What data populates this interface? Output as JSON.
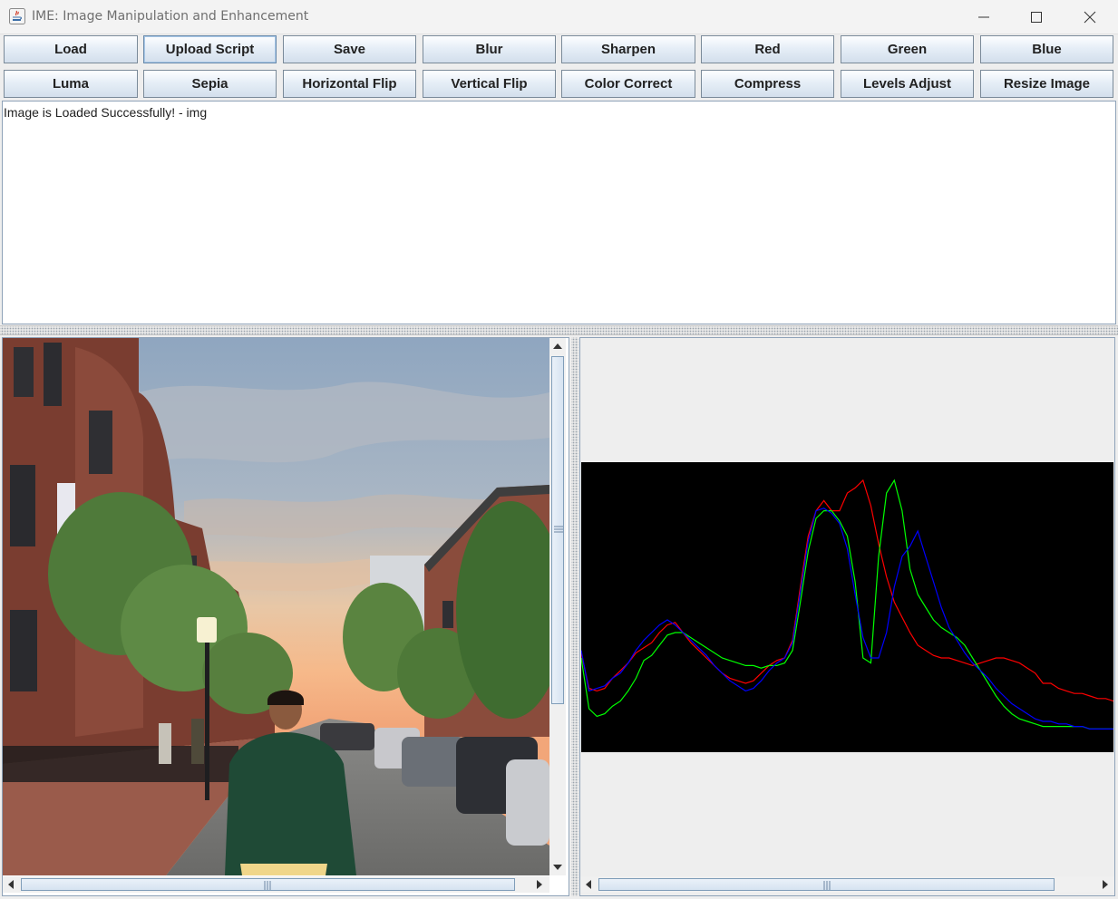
{
  "window": {
    "title": "IME: Image Manipulation and Enhancement"
  },
  "toolbar": {
    "row1": [
      "Load",
      "Upload Script",
      "Save",
      "Blur",
      "Sharpen",
      "Red",
      "Green",
      "Blue"
    ],
    "row2": [
      "Luma",
      "Sepia",
      "Horizontal Flip",
      "Vertical Flip",
      "Color Correct",
      "Compress",
      "Levels Adjust",
      "Resize Image"
    ]
  },
  "log": {
    "message": "Image is Loaded Successfully! - img"
  },
  "histogram": {
    "background": "#000000",
    "series": [
      {
        "color": "#ff0000",
        "values": [
          0.32,
          0.18,
          0.17,
          0.18,
          0.22,
          0.25,
          0.28,
          0.32,
          0.34,
          0.36,
          0.4,
          0.43,
          0.44,
          0.4,
          0.36,
          0.33,
          0.3,
          0.27,
          0.24,
          0.22,
          0.21,
          0.2,
          0.21,
          0.24,
          0.27,
          0.29,
          0.3,
          0.37,
          0.58,
          0.78,
          0.88,
          0.92,
          0.88,
          0.88,
          0.95,
          0.97,
          1.0,
          0.9,
          0.75,
          0.62,
          0.52,
          0.46,
          0.4,
          0.35,
          0.33,
          0.31,
          0.3,
          0.3,
          0.29,
          0.28,
          0.27,
          0.28,
          0.29,
          0.3,
          0.3,
          0.29,
          0.28,
          0.26,
          0.24,
          0.2,
          0.2,
          0.18,
          0.17,
          0.16,
          0.16,
          0.15,
          0.14,
          0.14,
          0.13
        ]
      },
      {
        "color": "#00ff00",
        "values": [
          0.3,
          0.1,
          0.07,
          0.08,
          0.11,
          0.13,
          0.17,
          0.22,
          0.29,
          0.31,
          0.35,
          0.39,
          0.4,
          0.4,
          0.38,
          0.36,
          0.34,
          0.32,
          0.3,
          0.29,
          0.28,
          0.27,
          0.27,
          0.26,
          0.27,
          0.27,
          0.28,
          0.33,
          0.52,
          0.72,
          0.85,
          0.88,
          0.88,
          0.84,
          0.78,
          0.6,
          0.3,
          0.28,
          0.7,
          0.95,
          1.0,
          0.88,
          0.65,
          0.55,
          0.5,
          0.45,
          0.42,
          0.4,
          0.38,
          0.35,
          0.3,
          0.25,
          0.2,
          0.15,
          0.11,
          0.08,
          0.06,
          0.05,
          0.04,
          0.03,
          0.03,
          0.03,
          0.03,
          0.03,
          0.03,
          0.02,
          0.02,
          0.02,
          0.02
        ]
      },
      {
        "color": "#0000ff",
        "values": [
          0.33,
          0.17,
          0.18,
          0.19,
          0.22,
          0.24,
          0.28,
          0.33,
          0.37,
          0.4,
          0.43,
          0.45,
          0.43,
          0.4,
          0.37,
          0.34,
          0.31,
          0.27,
          0.24,
          0.21,
          0.19,
          0.17,
          0.18,
          0.21,
          0.25,
          0.28,
          0.3,
          0.36,
          0.56,
          0.76,
          0.88,
          0.89,
          0.87,
          0.83,
          0.73,
          0.55,
          0.38,
          0.3,
          0.3,
          0.4,
          0.58,
          0.7,
          0.74,
          0.8,
          0.7,
          0.6,
          0.5,
          0.42,
          0.37,
          0.32,
          0.28,
          0.25,
          0.22,
          0.18,
          0.15,
          0.12,
          0.1,
          0.08,
          0.06,
          0.05,
          0.05,
          0.04,
          0.04,
          0.03,
          0.03,
          0.02,
          0.02,
          0.02,
          0.02
        ]
      }
    ]
  }
}
